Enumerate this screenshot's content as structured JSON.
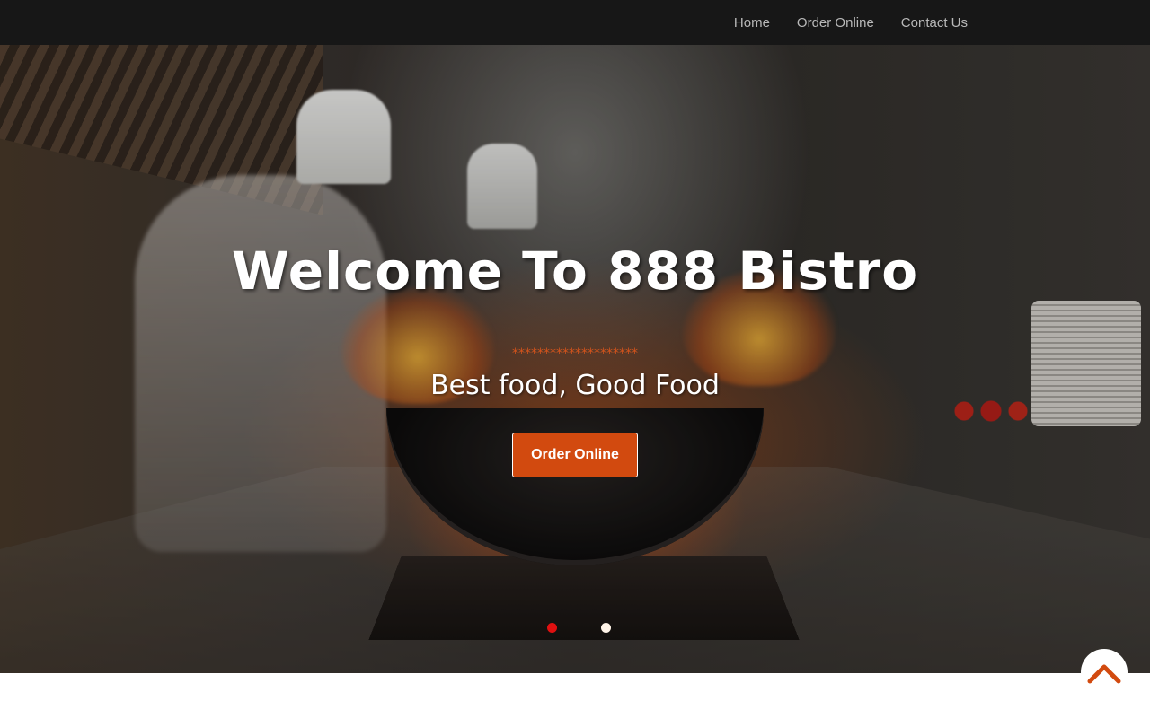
{
  "nav": {
    "items": [
      {
        "label": "Home"
      },
      {
        "label": "Order Online"
      },
      {
        "label": "Contact Us"
      }
    ]
  },
  "hero": {
    "title": "Welcome To 888 Bistro",
    "stars": "********************",
    "subtitle": "Best food, Good Food",
    "button_label": "Order Online",
    "slides": {
      "count": 2,
      "active": 1
    }
  },
  "scroll_top": {
    "icon": "chevron-up-icon"
  },
  "colors": {
    "navbar_bg": "#171717",
    "nav_text": "#b9b9b9",
    "accent": "#d24a0f",
    "active_dot": "#e01010",
    "inactive_dot": "#fff4e8"
  }
}
